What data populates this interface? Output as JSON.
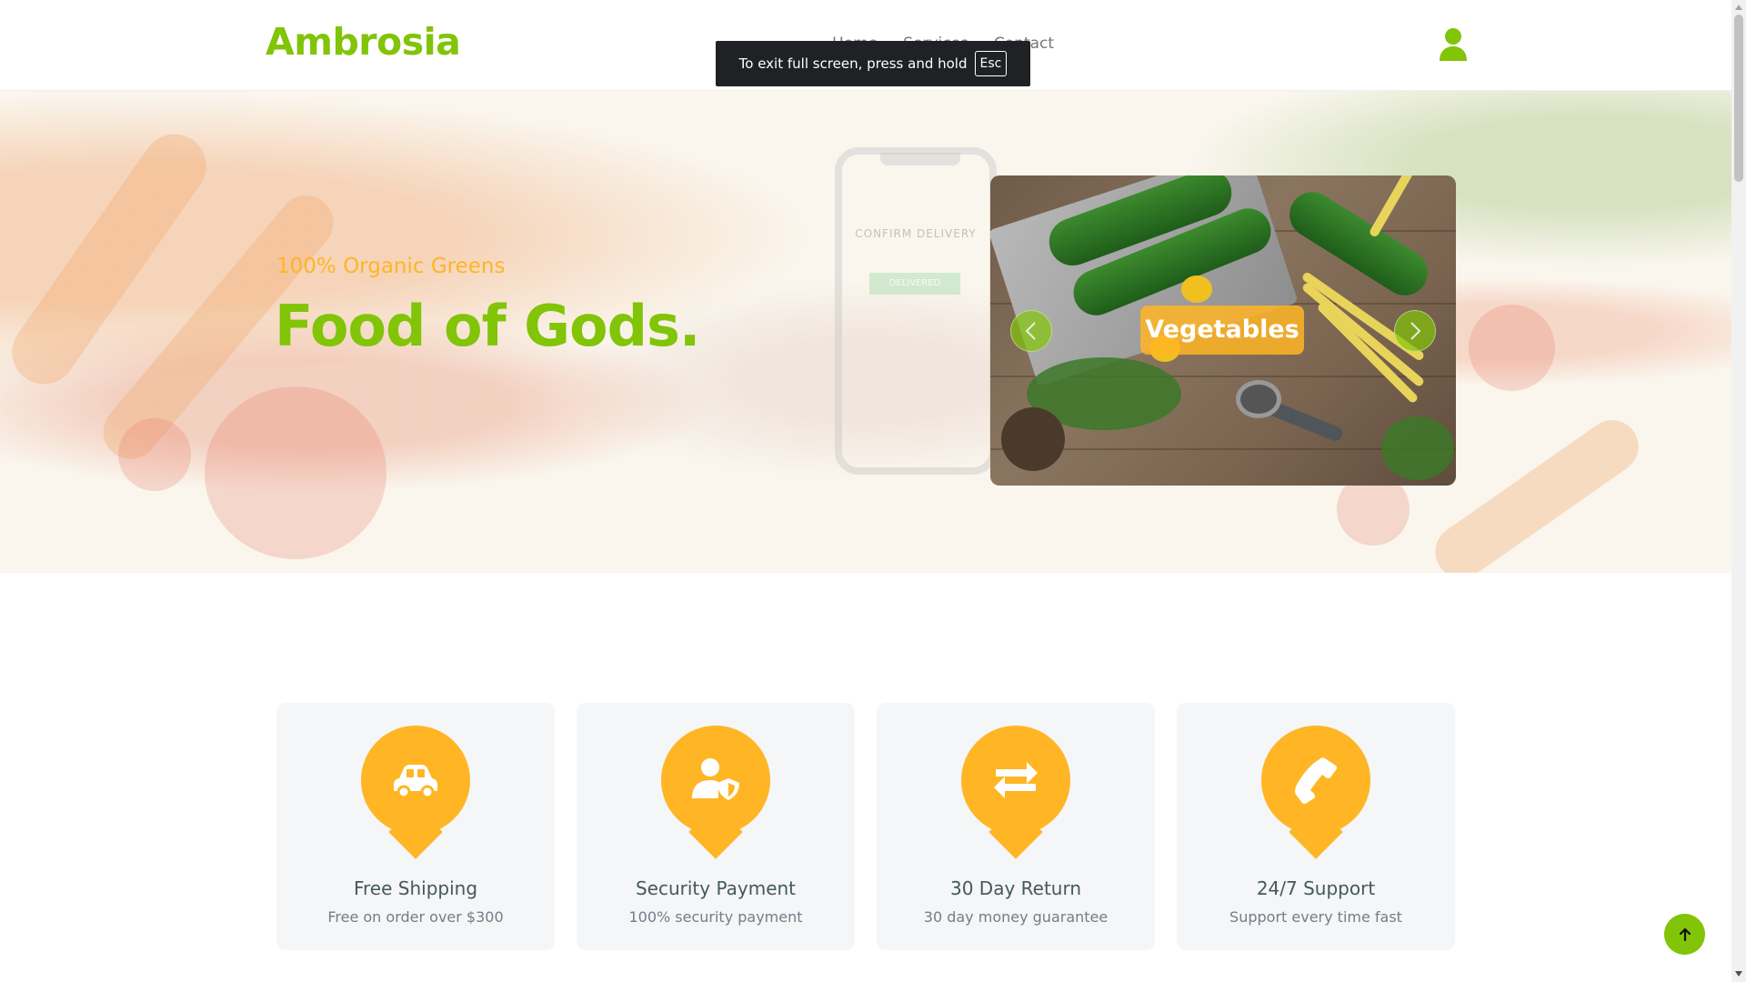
{
  "header": {
    "logo": "Ambrosia",
    "nav": [
      "Home",
      "Services",
      "Contact"
    ]
  },
  "toast": {
    "text": "To exit full screen, press and hold",
    "key": "Esc"
  },
  "hero": {
    "tagline": "100% Organic Greens",
    "headline": "Food of Gods.",
    "phone_text": "CONFIRM DELIVERY",
    "phone_button": "DELIVERED",
    "carousel_label": "Vegetables"
  },
  "features": [
    {
      "title": "Free Shipping",
      "subtitle": "Free on order over $300",
      "icon": "car-icon"
    },
    {
      "title": "Security Payment",
      "subtitle": "100% security payment",
      "icon": "user-shield-icon"
    },
    {
      "title": "30 Day Return",
      "subtitle": "30 day money guarantee",
      "icon": "exchange-icon"
    },
    {
      "title": "24/7 Support",
      "subtitle": "Support every time fast",
      "icon": "phone-icon"
    }
  ],
  "colors": {
    "primary_green": "#81c408",
    "accent_orange": "#ffb524",
    "card_bg": "#f4f6f8",
    "text_dark": "#45595b"
  }
}
